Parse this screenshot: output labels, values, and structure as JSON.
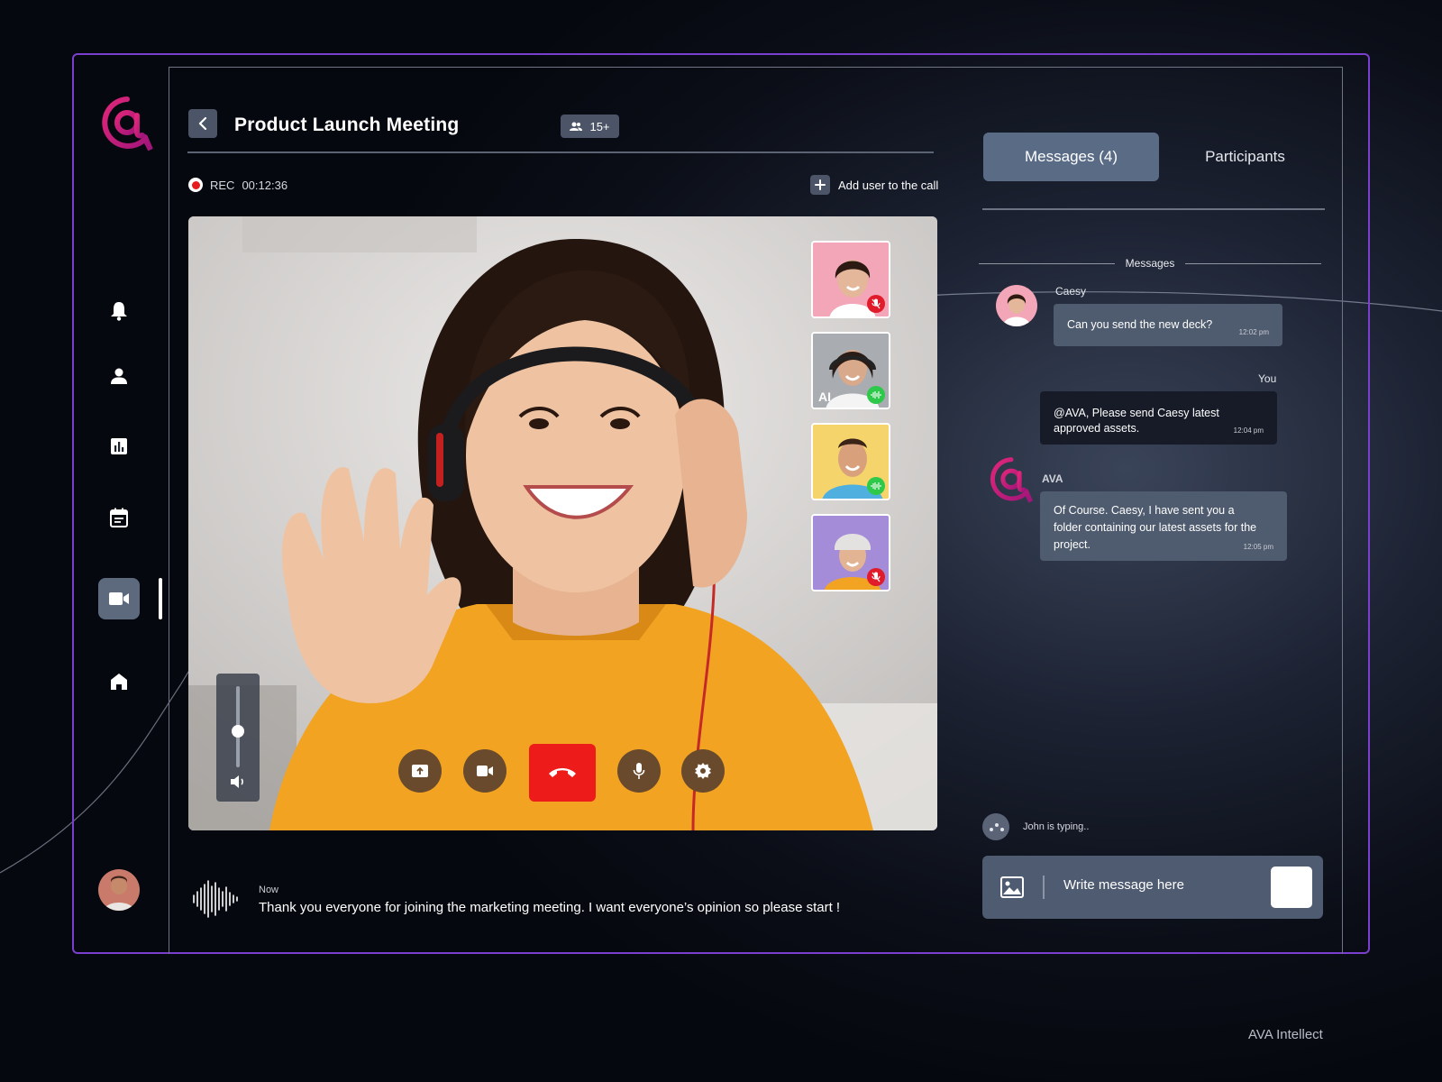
{
  "header": {
    "title": "Product Launch Meeting",
    "participant_count": "15+"
  },
  "recording": {
    "label": "REC",
    "elapsed": "00:12:36"
  },
  "add_user_label": "Add user to the call",
  "sidebar": {
    "items": [
      {
        "icon": "bell-icon"
      },
      {
        "icon": "person-icon"
      },
      {
        "icon": "bar-chart-icon"
      },
      {
        "icon": "calendar-icon"
      },
      {
        "icon": "video-camera-icon",
        "active": true
      },
      {
        "icon": "home-icon"
      }
    ]
  },
  "video": {
    "thumbnails": [
      {
        "status": "muted"
      },
      {
        "status": "speaking",
        "label": "AI"
      },
      {
        "status": "speaking"
      },
      {
        "status": "muted"
      }
    ],
    "volume_level": 0.45,
    "controls": [
      "share-screen-icon",
      "video-camera-icon",
      "hang-up-icon",
      "microphone-icon",
      "settings-icon"
    ]
  },
  "caption": {
    "time": "Now",
    "text": "Thank you everyone for joining the marketing meeting. I want everyone’s opinion so please start !"
  },
  "tabs": {
    "messages": "Messages (4)",
    "participants": "Participants"
  },
  "messages_divider": "Messages",
  "messages": [
    {
      "sender": "Caesy",
      "text": "Can you send the new deck?",
      "time": "12:02 pm"
    },
    {
      "sender": "You",
      "text": "@AVA, Please send Caesy latest approved assets.",
      "time": "12:04 pm"
    },
    {
      "sender": "AVA",
      "text": "Of Course. Caesy, I have sent you a folder containing our latest assets for the project.",
      "time": "12:05 pm"
    }
  ],
  "typing_indicator": "John is typing..",
  "composer": {
    "placeholder": "Write message here"
  },
  "brand": "AVA Intellect",
  "colors": {
    "accent_purple": "#7b3fd0",
    "logo_magenta": "#d0217d",
    "hangup_red": "#ee1b1b",
    "active_tab": "#5a6b86",
    "muted_badge": "#e01b2a",
    "speaking_badge": "#2ec84a"
  }
}
